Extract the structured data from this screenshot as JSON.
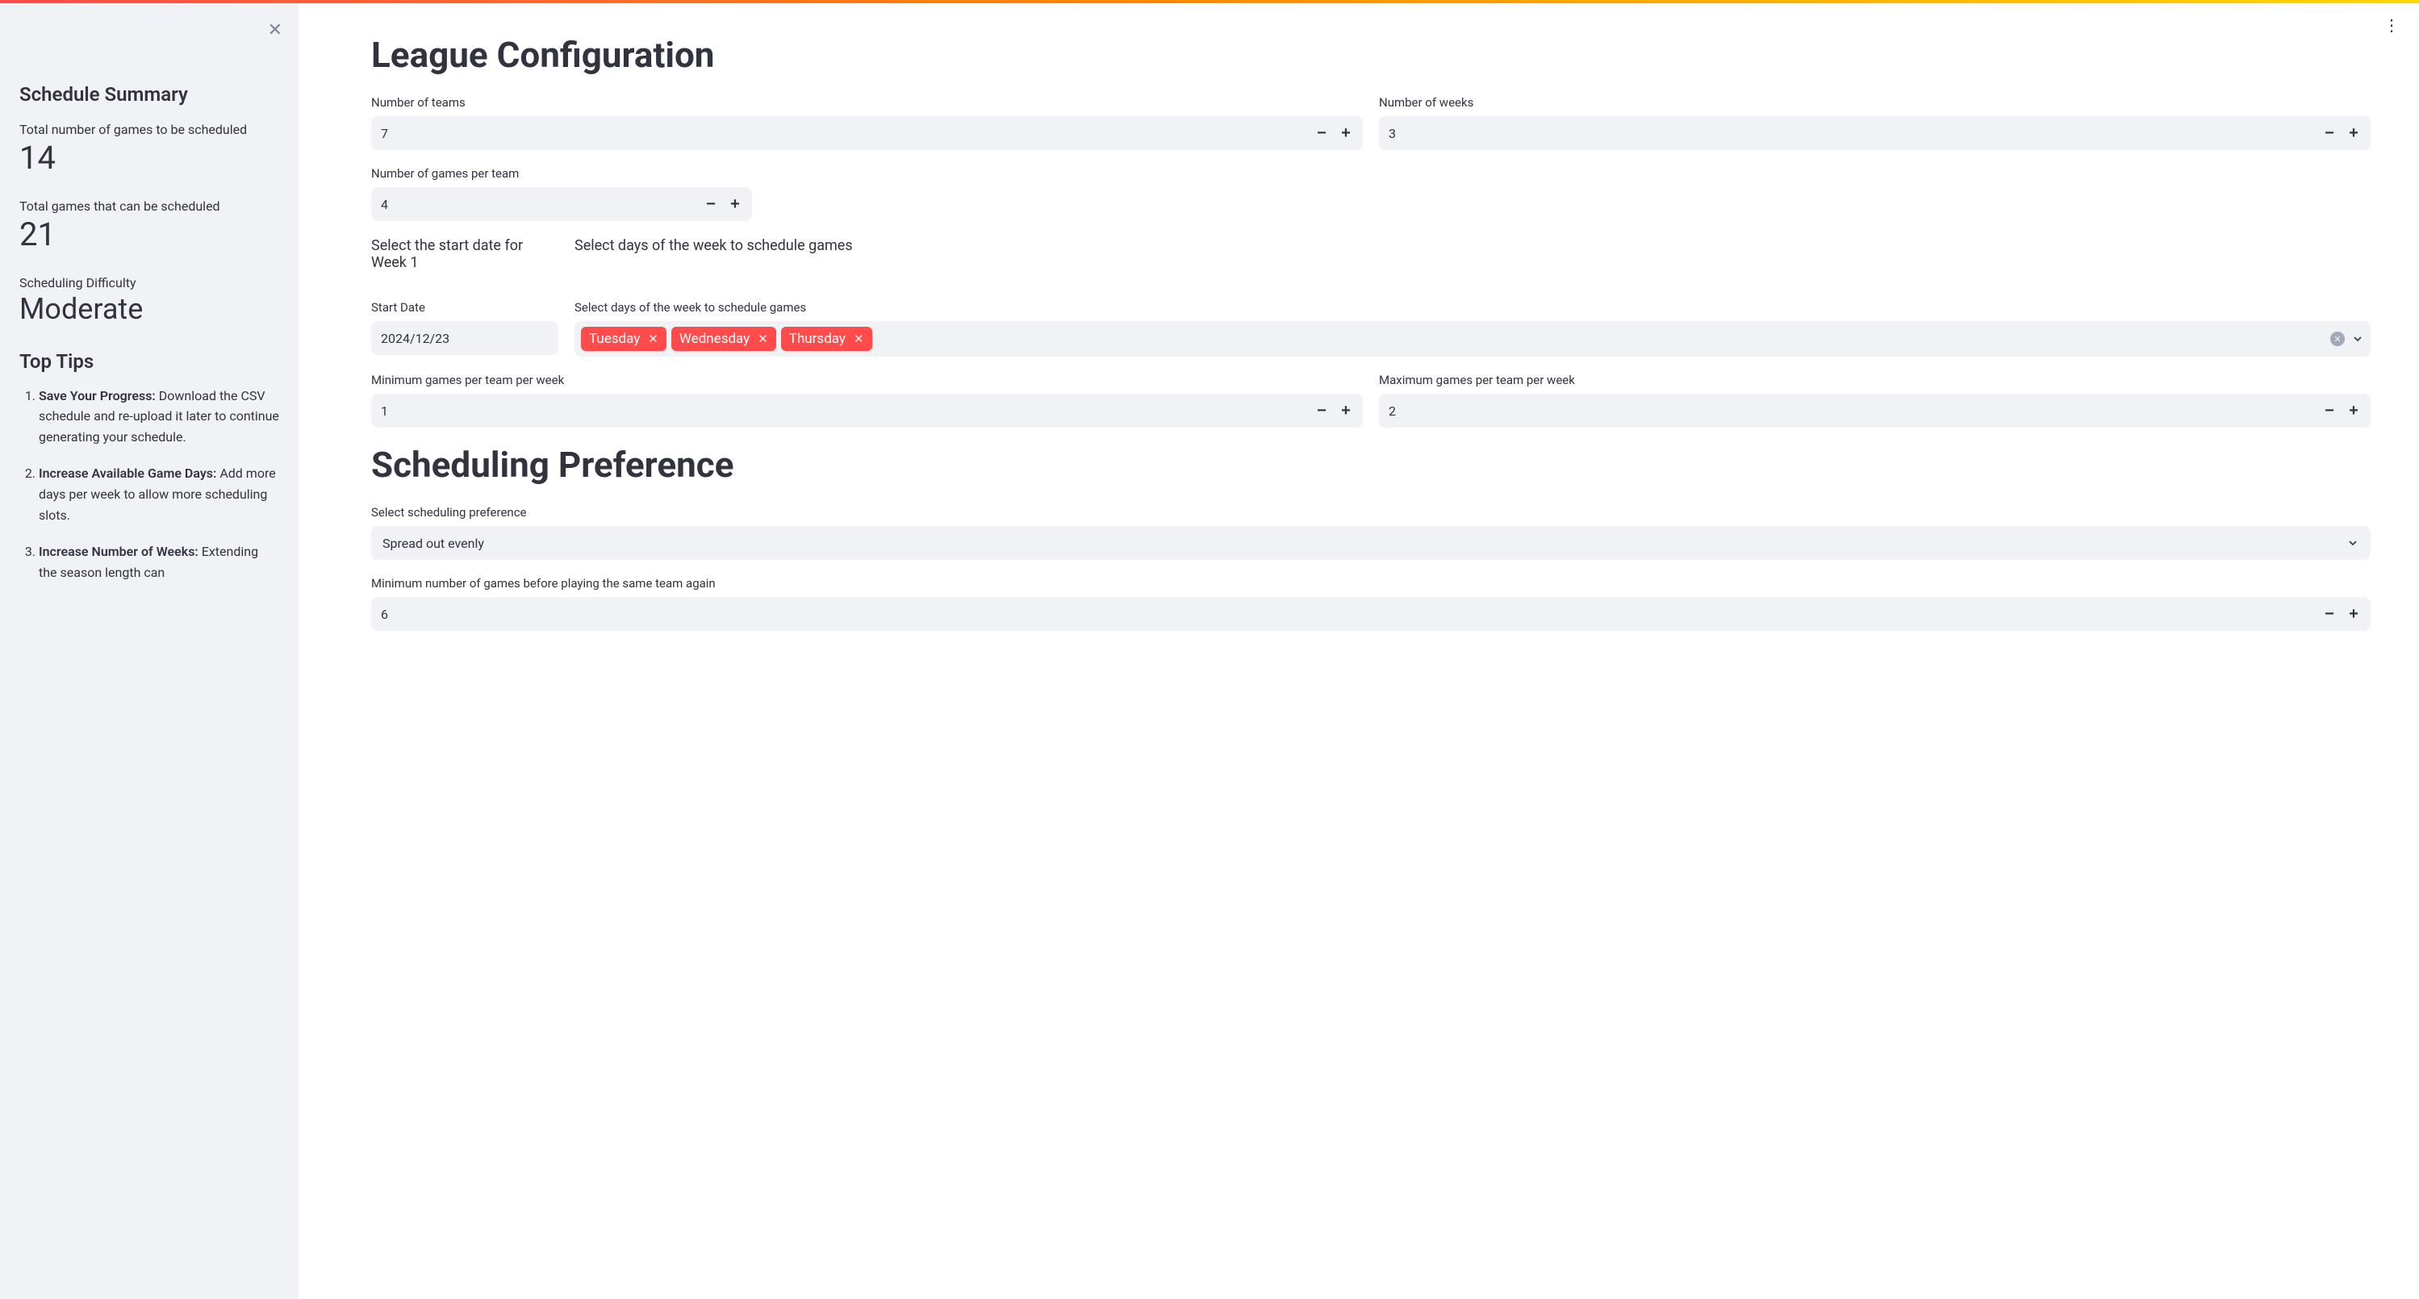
{
  "sidebar": {
    "title": "Schedule Summary",
    "metric1_label": "Total number of games to be scheduled",
    "metric1_value": "14",
    "metric2_label": "Total games that can be scheduled",
    "metric2_value": "21",
    "metric3_label": "Scheduling Difficulty",
    "metric3_value": "Moderate",
    "tips_heading": "Top Tips",
    "tips": [
      {
        "bold": "Save Your Progress:",
        "text": " Download the CSV schedule and re-upload it later to continue generating your schedule."
      },
      {
        "bold": "Increase Available Game Days:",
        "text": " Add more days per week to allow more scheduling slots."
      },
      {
        "bold": "Increase Number of Weeks:",
        "text": " Extending the season length can"
      }
    ]
  },
  "main": {
    "section1_title": "League Configuration",
    "num_teams_label": "Number of teams",
    "num_teams_value": "7",
    "num_weeks_label": "Number of weeks",
    "num_weeks_value": "3",
    "games_per_team_label": "Number of games per team",
    "games_per_team_value": "4",
    "start_date_section_label": "Select the start date for Week 1",
    "days_section_label": "Select days of the week to schedule games",
    "start_date_label": "Start Date",
    "start_date_value": "2024/12/23",
    "days_label": "Select days of the week to schedule games",
    "days_selected": [
      "Tuesday",
      "Wednesday",
      "Thursday"
    ],
    "min_games_week_label": "Minimum games per team per week",
    "min_games_week_value": "1",
    "max_games_week_label": "Maximum games per team per week",
    "max_games_week_value": "2",
    "section2_title": "Scheduling Preference",
    "pref_label": "Select scheduling preference",
    "pref_value": "Spread out evenly",
    "min_before_repeat_label": "Minimum number of games before playing the same team again",
    "min_before_repeat_value": "6"
  }
}
